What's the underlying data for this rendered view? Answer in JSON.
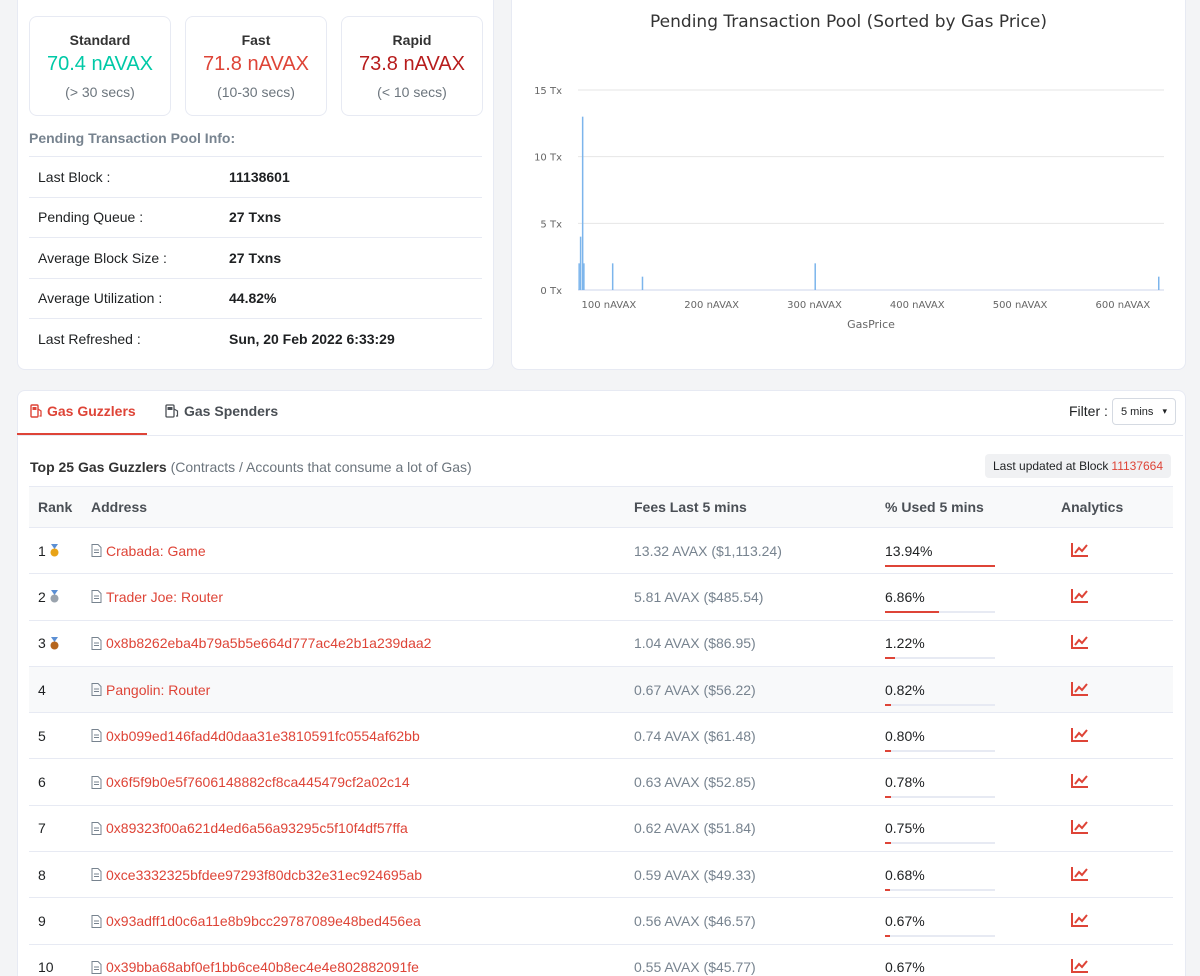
{
  "gas": [
    {
      "title": "Standard",
      "value": "70.4 nAVAX",
      "time": "(> 30 secs)",
      "color": "#00c9a7"
    },
    {
      "title": "Fast",
      "value": "71.8 nAVAX",
      "time": "(10-30 secs)",
      "color": "#de4437"
    },
    {
      "title": "Rapid",
      "value": "73.8 nAVAX",
      "time": "(< 10 secs)",
      "color": "#b71c1c"
    }
  ],
  "pool": {
    "title": "Pending Transaction Pool Info:",
    "rows": [
      {
        "label": "Last Block :",
        "value": "11138601"
      },
      {
        "label": "Pending Queue :",
        "value": "27 Txns"
      },
      {
        "label": "Average Block Size :",
        "value": "27 Txns"
      },
      {
        "label": "Average Utilization :",
        "value": "44.82%"
      },
      {
        "label": "Last Refreshed :",
        "value": "Sun, 20 Feb 2022 6:33:29"
      }
    ]
  },
  "chart_data": {
    "type": "bar",
    "title": "Pending Transaction Pool (Sorted by Gas Price)",
    "xlabel": "GasPrice",
    "ylabel": "",
    "xlim": [
      70,
      640
    ],
    "ylim": [
      0,
      15
    ],
    "xticks": [
      {
        "v": 100,
        "label": "100 nAVAX"
      },
      {
        "v": 200,
        "label": "200 nAVAX"
      },
      {
        "v": 300,
        "label": "300 nAVAX"
      },
      {
        "v": 400,
        "label": "400 nAVAX"
      },
      {
        "v": 500,
        "label": "500 nAVAX"
      },
      {
        "v": 600,
        "label": "600 nAVAX"
      }
    ],
    "yticks": [
      {
        "v": 0,
        "label": "0 Tx"
      },
      {
        "v": 5,
        "label": "5 Tx"
      },
      {
        "v": 10,
        "label": "10 Tx"
      },
      {
        "v": 15,
        "label": "15 Tx"
      }
    ],
    "grid": true,
    "color": "#7cb5ec",
    "points": [
      {
        "x": 70.4,
        "y": 2
      },
      {
        "x": 71.8,
        "y": 4
      },
      {
        "x": 73.8,
        "y": 13
      },
      {
        "x": 75,
        "y": 2
      },
      {
        "x": 103,
        "y": 2
      },
      {
        "x": 132,
        "y": 1
      },
      {
        "x": 300,
        "y": 2
      },
      {
        "x": 655,
        "y": 1
      }
    ]
  },
  "tabs": {
    "guzzlers": "Gas Guzzlers",
    "spenders": "Gas Spenders"
  },
  "filter": {
    "label": "Filter :",
    "value": "5 mins"
  },
  "top": {
    "title": "Top 25 Gas Guzzlers",
    "subtitle": "(Contracts / Accounts that consume a lot of Gas)",
    "updated_label": "Last updated at Block",
    "updated_block": "11137664"
  },
  "table": {
    "headers": {
      "rank": "Rank",
      "address": "Address",
      "fees": "Fees Last 5 mins",
      "pct": "% Used 5 mins",
      "analytics": "Analytics"
    },
    "rows": [
      {
        "rank": "1",
        "medal": "gold",
        "address": "Crabada: Game",
        "fees": "13.32 AVAX ($1,113.24)",
        "pct": "13.94%",
        "pct_value": 13.94
      },
      {
        "rank": "2",
        "medal": "silver",
        "address": "Trader Joe: Router",
        "fees": "5.81 AVAX ($485.54)",
        "pct": "6.86%",
        "pct_value": 6.86
      },
      {
        "rank": "3",
        "medal": "bronze",
        "address": "0x8b8262eba4b79a5b5e664d777ac4e2b1a239daa2",
        "fees": "1.04 AVAX ($86.95)",
        "pct": "1.22%",
        "pct_value": 1.22
      },
      {
        "rank": "4",
        "medal": "",
        "address": "Pangolin: Router",
        "fees": "0.67 AVAX ($56.22)",
        "pct": "0.82%",
        "pct_value": 0.82
      },
      {
        "rank": "5",
        "medal": "",
        "address": "0xb099ed146fad4d0daa31e3810591fc0554af62bb",
        "fees": "0.74 AVAX ($61.48)",
        "pct": "0.80%",
        "pct_value": 0.8
      },
      {
        "rank": "6",
        "medal": "",
        "address": "0x6f5f9b0e5f7606148882cf8ca445479cf2a02c14",
        "fees": "0.63 AVAX ($52.85)",
        "pct": "0.78%",
        "pct_value": 0.78
      },
      {
        "rank": "7",
        "medal": "",
        "address": "0x89323f00a621d4ed6a56a93295c5f10f4df57ffa",
        "fees": "0.62 AVAX ($51.84)",
        "pct": "0.75%",
        "pct_value": 0.75
      },
      {
        "rank": "8",
        "medal": "",
        "address": "0xce3332325bfdee97293f80dcb32e31ec924695ab",
        "fees": "0.59 AVAX ($49.33)",
        "pct": "0.68%",
        "pct_value": 0.68
      },
      {
        "rank": "9",
        "medal": "",
        "address": "0x93adff1d0c6a11e8b9bcc29787089e48bed456ea",
        "fees": "0.56 AVAX ($46.57)",
        "pct": "0.67%",
        "pct_value": 0.67
      },
      {
        "rank": "10",
        "medal": "",
        "address": "0x39bba68abf0ef1bb6ce40b8ec4e4e802882091fe",
        "fees": "0.55 AVAX ($45.77)",
        "pct": "0.67%",
        "pct_value": 0.67
      }
    ]
  }
}
